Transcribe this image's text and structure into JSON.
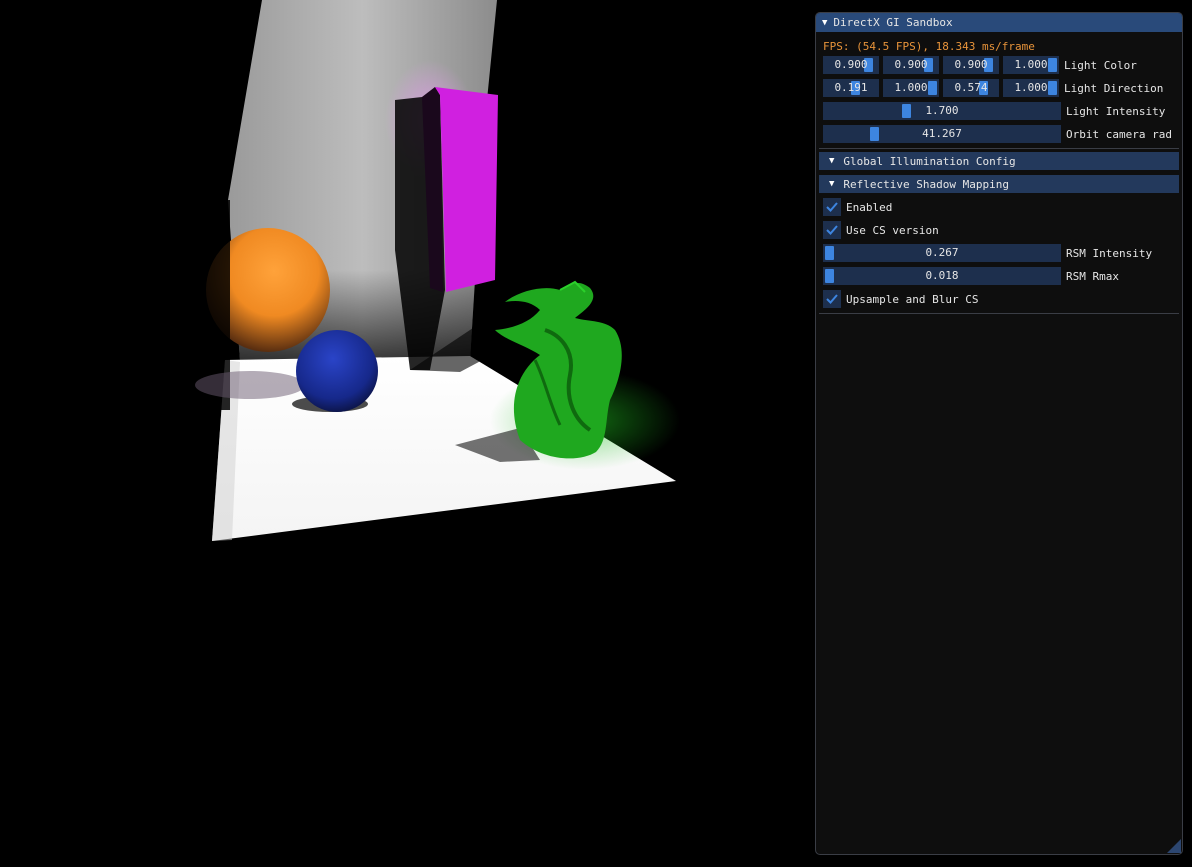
{
  "window": {
    "title": "DirectX GI Sandbox"
  },
  "fps_text": "FPS: (54.5 FPS), 18.343 ms/frame",
  "light_color": {
    "label": "Light Color",
    "values": [
      "0.900",
      "0.900",
      "0.900",
      "1.000"
    ],
    "fractions": [
      0.9,
      0.9,
      0.9,
      1.0
    ]
  },
  "light_direction": {
    "label": "Light Direction",
    "values": [
      "0.191",
      "1.000",
      "0.574",
      "1.000"
    ],
    "fractions": [
      0.595,
      1.0,
      0.787,
      1.0
    ]
  },
  "light_intensity": {
    "label": "Light Intensity",
    "value": "1.700",
    "fraction": 0.34
  },
  "orbit_camera": {
    "label": "Orbit camera rad",
    "value": "41.267",
    "fraction": 0.2
  },
  "headers": {
    "gi_config": "Global Illumination Config",
    "rsm": "Reflective Shadow Mapping"
  },
  "rsm": {
    "enabled": {
      "label": "Enabled",
      "checked": true
    },
    "use_cs": {
      "label": "Use CS version",
      "checked": true
    },
    "intensity": {
      "label": "RSM Intensity",
      "value": "0.267",
      "fraction": 0.0
    },
    "rmax": {
      "label": "RSM Rmax",
      "value": "0.018",
      "fraction": 0.0
    },
    "upsample": {
      "label": "Upsample and Blur CS",
      "checked": true
    }
  },
  "colors": {
    "title_bg": "#294a7a",
    "header_bg": "#23395c",
    "frame_bg": "#1d2f4d",
    "slider_grab": "#3d85e0",
    "fps_text": "#e8943a",
    "sphere_orange": "#f08a22",
    "sphere_blue": "#1a2fa0",
    "box_magenta": "#d020e0",
    "dragon_green": "#22b022"
  }
}
